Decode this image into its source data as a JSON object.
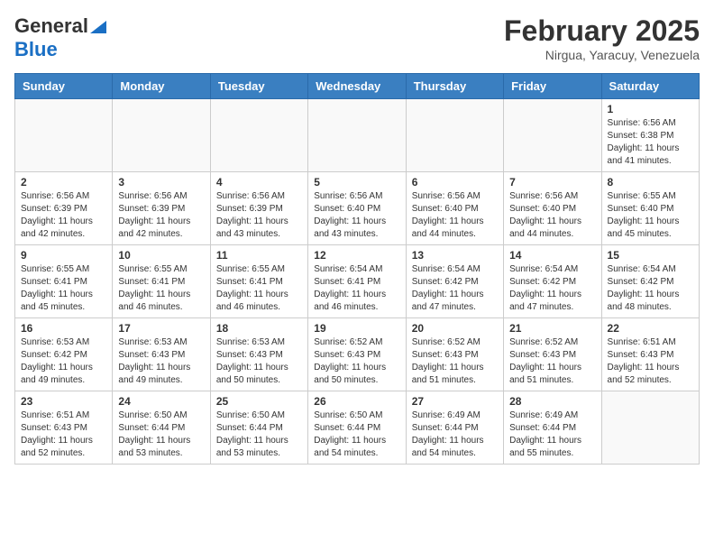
{
  "logo": {
    "line1": "General",
    "line2": "Blue"
  },
  "title": "February 2025",
  "subtitle": "Nirgua, Yaracuy, Venezuela",
  "weekdays": [
    "Sunday",
    "Monday",
    "Tuesday",
    "Wednesday",
    "Thursday",
    "Friday",
    "Saturday"
  ],
  "weeks": [
    [
      {
        "day": "",
        "info": ""
      },
      {
        "day": "",
        "info": ""
      },
      {
        "day": "",
        "info": ""
      },
      {
        "day": "",
        "info": ""
      },
      {
        "day": "",
        "info": ""
      },
      {
        "day": "",
        "info": ""
      },
      {
        "day": "1",
        "info": "Sunrise: 6:56 AM\nSunset: 6:38 PM\nDaylight: 11 hours\nand 41 minutes."
      }
    ],
    [
      {
        "day": "2",
        "info": "Sunrise: 6:56 AM\nSunset: 6:39 PM\nDaylight: 11 hours\nand 42 minutes."
      },
      {
        "day": "3",
        "info": "Sunrise: 6:56 AM\nSunset: 6:39 PM\nDaylight: 11 hours\nand 42 minutes."
      },
      {
        "day": "4",
        "info": "Sunrise: 6:56 AM\nSunset: 6:39 PM\nDaylight: 11 hours\nand 43 minutes."
      },
      {
        "day": "5",
        "info": "Sunrise: 6:56 AM\nSunset: 6:40 PM\nDaylight: 11 hours\nand 43 minutes."
      },
      {
        "day": "6",
        "info": "Sunrise: 6:56 AM\nSunset: 6:40 PM\nDaylight: 11 hours\nand 44 minutes."
      },
      {
        "day": "7",
        "info": "Sunrise: 6:56 AM\nSunset: 6:40 PM\nDaylight: 11 hours\nand 44 minutes."
      },
      {
        "day": "8",
        "info": "Sunrise: 6:55 AM\nSunset: 6:40 PM\nDaylight: 11 hours\nand 45 minutes."
      }
    ],
    [
      {
        "day": "9",
        "info": "Sunrise: 6:55 AM\nSunset: 6:41 PM\nDaylight: 11 hours\nand 45 minutes."
      },
      {
        "day": "10",
        "info": "Sunrise: 6:55 AM\nSunset: 6:41 PM\nDaylight: 11 hours\nand 46 minutes."
      },
      {
        "day": "11",
        "info": "Sunrise: 6:55 AM\nSunset: 6:41 PM\nDaylight: 11 hours\nand 46 minutes."
      },
      {
        "day": "12",
        "info": "Sunrise: 6:54 AM\nSunset: 6:41 PM\nDaylight: 11 hours\nand 46 minutes."
      },
      {
        "day": "13",
        "info": "Sunrise: 6:54 AM\nSunset: 6:42 PM\nDaylight: 11 hours\nand 47 minutes."
      },
      {
        "day": "14",
        "info": "Sunrise: 6:54 AM\nSunset: 6:42 PM\nDaylight: 11 hours\nand 47 minutes."
      },
      {
        "day": "15",
        "info": "Sunrise: 6:54 AM\nSunset: 6:42 PM\nDaylight: 11 hours\nand 48 minutes."
      }
    ],
    [
      {
        "day": "16",
        "info": "Sunrise: 6:53 AM\nSunset: 6:42 PM\nDaylight: 11 hours\nand 49 minutes."
      },
      {
        "day": "17",
        "info": "Sunrise: 6:53 AM\nSunset: 6:43 PM\nDaylight: 11 hours\nand 49 minutes."
      },
      {
        "day": "18",
        "info": "Sunrise: 6:53 AM\nSunset: 6:43 PM\nDaylight: 11 hours\nand 50 minutes."
      },
      {
        "day": "19",
        "info": "Sunrise: 6:52 AM\nSunset: 6:43 PM\nDaylight: 11 hours\nand 50 minutes."
      },
      {
        "day": "20",
        "info": "Sunrise: 6:52 AM\nSunset: 6:43 PM\nDaylight: 11 hours\nand 51 minutes."
      },
      {
        "day": "21",
        "info": "Sunrise: 6:52 AM\nSunset: 6:43 PM\nDaylight: 11 hours\nand 51 minutes."
      },
      {
        "day": "22",
        "info": "Sunrise: 6:51 AM\nSunset: 6:43 PM\nDaylight: 11 hours\nand 52 minutes."
      }
    ],
    [
      {
        "day": "23",
        "info": "Sunrise: 6:51 AM\nSunset: 6:43 PM\nDaylight: 11 hours\nand 52 minutes."
      },
      {
        "day": "24",
        "info": "Sunrise: 6:50 AM\nSunset: 6:44 PM\nDaylight: 11 hours\nand 53 minutes."
      },
      {
        "day": "25",
        "info": "Sunrise: 6:50 AM\nSunset: 6:44 PM\nDaylight: 11 hours\nand 53 minutes."
      },
      {
        "day": "26",
        "info": "Sunrise: 6:50 AM\nSunset: 6:44 PM\nDaylight: 11 hours\nand 54 minutes."
      },
      {
        "day": "27",
        "info": "Sunrise: 6:49 AM\nSunset: 6:44 PM\nDaylight: 11 hours\nand 54 minutes."
      },
      {
        "day": "28",
        "info": "Sunrise: 6:49 AM\nSunset: 6:44 PM\nDaylight: 11 hours\nand 55 minutes."
      },
      {
        "day": "",
        "info": ""
      }
    ]
  ]
}
